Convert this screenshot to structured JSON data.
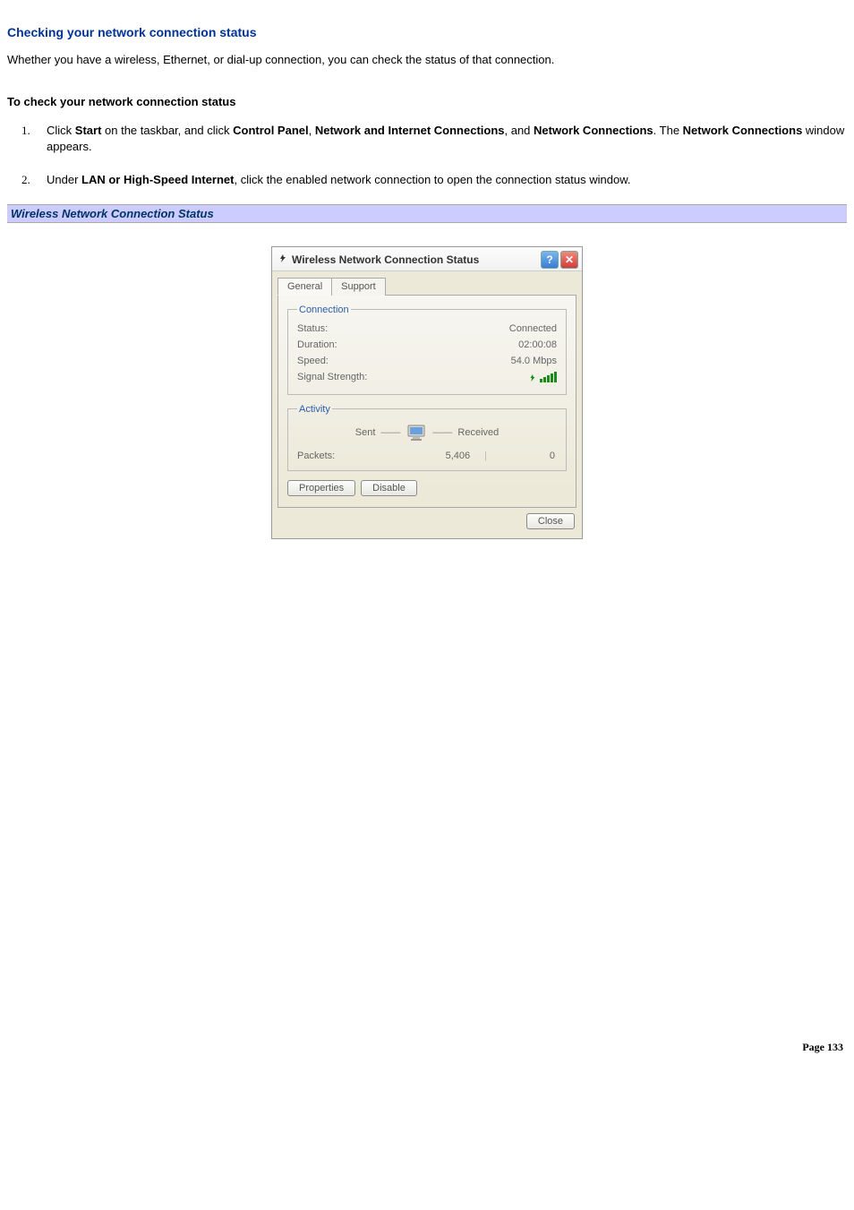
{
  "heading": "Checking your network connection status",
  "intro": "Whether you have a wireless, Ethernet, or dial-up connection, you can check the status of that connection.",
  "subheading": "To check your network connection status",
  "steps": [
    {
      "num": "1.",
      "pre": "Click ",
      "b1": "Start",
      "mid1": " on the taskbar, and click ",
      "b2": "Control Panel",
      "mid2": ", ",
      "b3": "Network and Internet Connections",
      "mid3": ", and ",
      "b4": "Network Connections",
      "mid4": ". The ",
      "b5": "Network Connections",
      "post": " window appears."
    },
    {
      "num": "2.",
      "pre": "Under ",
      "b1": "LAN or High-Speed Internet",
      "post": ", click the enabled network connection to open the connection status window."
    }
  ],
  "caption": "Wireless Network Connection Status",
  "dialog": {
    "title": "Wireless Network Connection Status",
    "tabs": {
      "general": "General",
      "support": "Support"
    },
    "connection": {
      "legend": "Connection",
      "status_label": "Status:",
      "status_value": "Connected",
      "duration_label": "Duration:",
      "duration_value": "02:00:08",
      "speed_label": "Speed:",
      "speed_value": "54.0 Mbps",
      "signal_label": "Signal Strength:"
    },
    "activity": {
      "legend": "Activity",
      "sent": "Sent",
      "received": "Received",
      "packets_label": "Packets:",
      "packets_sent": "5,406",
      "packets_received": "0"
    },
    "buttons": {
      "properties": "Properties",
      "disable": "Disable",
      "close": "Close"
    }
  },
  "footer": {
    "label": "Page",
    "num": "133"
  }
}
